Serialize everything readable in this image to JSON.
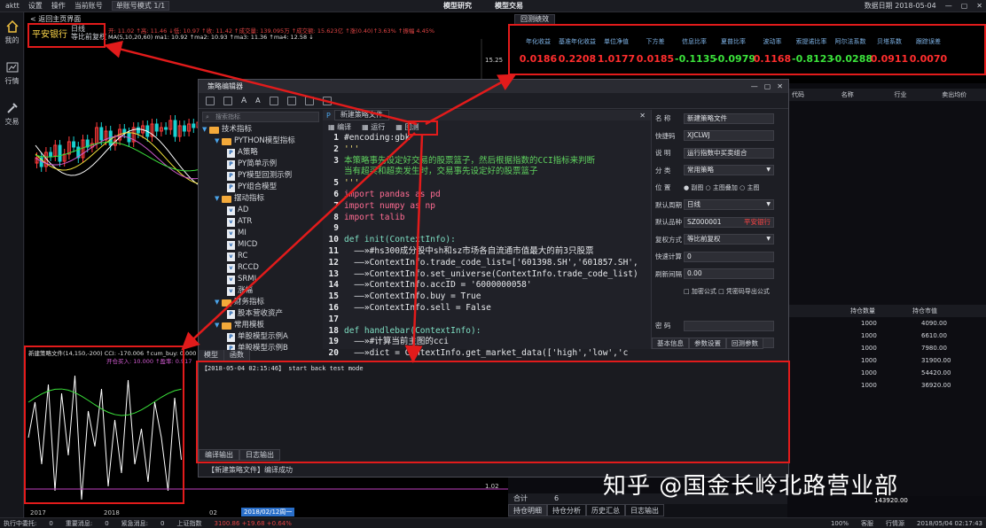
{
  "topbar": {
    "app": "aktt",
    "settings": "设置",
    "operate": "操作",
    "account": "当前账号",
    "mode": "单账号模式 1/1",
    "model_research": "模型研究",
    "model_trade": "模型交易",
    "data_date": "数据日期 2018-05-04"
  },
  "leftnav": [
    "我的",
    "行情",
    "交易"
  ],
  "chart": {
    "back": "< 返回主页界面",
    "stock": "平安银行",
    "period": "日线",
    "adjust": "等比前复权",
    "ohlc": "开: 11.02 ↑高: 11.46 ↓低: 10.97 ↑收: 11.42 ↑成交量: 139.095万 ↑成交额: 15.623亿 ↑涨(0.40)↑3.63% ↑振幅 4.45%",
    "ma": "MA(5,10,20,60) ma1: 10.92 ↑ma2: 10.93 ↑ma3: 11.36 ↑ma4: 12.58 ↓",
    "price_top": "15.25",
    "indicator": "新建策略文件(14,150,-200) CCI: -170.006 ↑cum_buy: 0.000",
    "indicator2": "开仓买入: 10.000 ↑盈率: 0.917",
    "cci_level": "1.02",
    "x_labels": [
      "2017",
      "2018",
      "02",
      "2018/02/12周一"
    ]
  },
  "backtest": {
    "tab": "回测绩效",
    "metrics": [
      {
        "label": "年化收益",
        "value": "0.0186",
        "color": "#ff2d2d"
      },
      {
        "label": "基准年化收益",
        "value": "0.2208",
        "color": "#ff2d2d"
      },
      {
        "label": "单位净值",
        "value": "1.0177",
        "color": "#ff2d2d"
      },
      {
        "label": "下方差",
        "value": "0.0185",
        "color": "#ff2d2d"
      },
      {
        "label": "信息比率",
        "value": "-0.1135",
        "color": "#3be33b"
      },
      {
        "label": "夏普比率",
        "value": "-0.0979",
        "color": "#3be33b"
      },
      {
        "label": "波动率",
        "value": "0.1168",
        "color": "#ff2d2d"
      },
      {
        "label": "索提诺比率",
        "value": "-0.8123",
        "color": "#3be33b"
      },
      {
        "label": "阿尔法系数",
        "value": "-0.0288",
        "color": "#3be33b"
      },
      {
        "label": "贝塔系数",
        "value": "0.0911",
        "color": "#ff2d2d"
      },
      {
        "label": "跟踪误差",
        "value": "0.0070",
        "color": "#ff2d2d"
      }
    ]
  },
  "grid": {
    "headers1": [
      "代码",
      "名称",
      "行业",
      "卖出均价"
    ],
    "headers2": [
      "持仓数量",
      "持仓市值"
    ],
    "rows": [
      [
        "1000",
        "4090.00"
      ],
      [
        "1000",
        "6610.00"
      ],
      [
        "1000",
        "7980.00"
      ],
      [
        "1000",
        "31900.00"
      ],
      [
        "1000",
        "54420.00"
      ],
      [
        "1000",
        "36920.00"
      ]
    ]
  },
  "editor": {
    "title": "策略编辑器",
    "tree_search": "搜索指标",
    "tree": [
      {
        "type": "folder",
        "level": 0,
        "label": "技术指标"
      },
      {
        "type": "folder",
        "level": 1,
        "label": "PYTHON模型指标"
      },
      {
        "type": "file",
        "level": 2,
        "icon": "P",
        "label": "A策略"
      },
      {
        "type": "file",
        "level": 2,
        "icon": "P",
        "label": "PY简单示例"
      },
      {
        "type": "file",
        "level": 2,
        "icon": "P",
        "label": "PY模型回测示例"
      },
      {
        "type": "file",
        "level": 2,
        "icon": "P",
        "label": "PY组合模型"
      },
      {
        "type": "folder",
        "level": 1,
        "label": "摆动指标"
      },
      {
        "type": "file",
        "level": 2,
        "icon": "v",
        "label": "AD"
      },
      {
        "type": "file",
        "level": 2,
        "icon": "v",
        "label": "ATR"
      },
      {
        "type": "file",
        "level": 2,
        "icon": "v",
        "label": "MI"
      },
      {
        "type": "file",
        "level": 2,
        "icon": "v",
        "label": "MICD"
      },
      {
        "type": "file",
        "level": 2,
        "icon": "v",
        "label": "RC"
      },
      {
        "type": "file",
        "level": 2,
        "icon": "v",
        "label": "RCCD"
      },
      {
        "type": "file",
        "level": 2,
        "icon": "v",
        "label": "SRMI"
      },
      {
        "type": "file",
        "level": 2,
        "icon": "v",
        "label": "涨幅"
      },
      {
        "type": "folder",
        "level": 1,
        "label": "财务指标"
      },
      {
        "type": "file",
        "level": 2,
        "icon": "P",
        "label": "股本营收资产"
      },
      {
        "type": "folder",
        "level": 1,
        "label": "常用模板"
      },
      {
        "type": "file",
        "level": 2,
        "icon": "P",
        "label": "单股模型示例A"
      },
      {
        "type": "file",
        "level": 2,
        "icon": "P",
        "label": "单股模型示例B"
      }
    ],
    "tree_tabs": [
      "模型",
      "函数"
    ],
    "code_tab": "新建策略文件",
    "code_toolbar": [
      "编译",
      "运行",
      "回测"
    ],
    "code": [
      {
        "n": "1",
        "t": "#encoding:gbk",
        "c": "ct"
      },
      {
        "n": "2",
        "t": "'''",
        "c": "st"
      },
      {
        "n": "3",
        "t": "本策略事先设定好交易的股票篮子，然后根据指数的CCI指标来判断",
        "c": "cm"
      },
      {
        "n": "",
        "t": "当有超买和超卖发生时，交易事先设定好的股票篮子",
        "c": "cm"
      },
      {
        "n": "5",
        "t": "'''",
        "c": "st"
      },
      {
        "n": "6",
        "t": "import pandas as pd",
        "c": "kw"
      },
      {
        "n": "7",
        "t": "import numpy as np",
        "c": "kw"
      },
      {
        "n": "8",
        "t": "import talib",
        "c": "kw"
      },
      {
        "n": "9",
        "t": "",
        "c": "ct"
      },
      {
        "n": "10",
        "t": "def init(ContextInfo):",
        "c": "fn"
      },
      {
        "n": "11",
        "t": "  ——»#hs300成分股中sh和sz市场各自流通市值最大的前3只股票",
        "c": "ct"
      },
      {
        "n": "12",
        "t": "  ——»ContextInfo.trade_code_list=['601398.SH','601857.SH',",
        "c": "ct"
      },
      {
        "n": "13",
        "t": "  ——»ContextInfo.set_universe(ContextInfo.trade_code_list)",
        "c": "ct"
      },
      {
        "n": "14",
        "t": "  ——»ContextInfo.accID = '6000000058'",
        "c": "ct"
      },
      {
        "n": "15",
        "t": "  ——»ContextInfo.buy = True",
        "c": "ct"
      },
      {
        "n": "16",
        "t": "  ——»ContextInfo.sell = False",
        "c": "ct"
      },
      {
        "n": "17",
        "t": "",
        "c": "ct"
      },
      {
        "n": "18",
        "t": "def handlebar(ContextInfo):",
        "c": "fn"
      },
      {
        "n": "19",
        "t": "  ——»#计算当前主图的cci",
        "c": "ct"
      },
      {
        "n": "20",
        "t": "  ——»dict = ContextInfo.get_market_data(['high','low','c",
        "c": "ct"
      }
    ],
    "props": [
      {
        "label": "名  称",
        "value": "新建策略文件"
      },
      {
        "label": "快捷码",
        "value": "XJCLWJ"
      },
      {
        "label": "说  明",
        "value": "运行指数中买卖组合"
      },
      {
        "label": "分  类",
        "value": "常用策略",
        "dd": true
      },
      {
        "label": "位  置",
        "value": "● 副图  ○ 主图叠加  ○ 主图",
        "plain": true
      },
      {
        "label": "默认周期",
        "value": "日线",
        "dd": true
      },
      {
        "label": "默认品种",
        "value": "SZ000001",
        "extra": "平安银行"
      },
      {
        "label": "复权方式",
        "value": "等比前复权",
        "dd": true
      },
      {
        "label": "快速计算",
        "value": "0"
      },
      {
        "label": "刷新间隔",
        "value": "0.00"
      },
      {
        "label": "",
        "value": "□ 加密公式   □ 凭密码导出公式",
        "plain": true
      },
      {
        "label": "",
        "value": "",
        "plain": true
      },
      {
        "label": "密  码",
        "value": ""
      },
      {
        "label": "确认密码",
        "value": ""
      }
    ],
    "props_tabs": [
      "基本信息",
      "参数设置",
      "回测参数"
    ],
    "log_line": "【2018-05-04 02:15:46】 start back test mode",
    "log_tabs": [
      "编译输出",
      "日志输出"
    ],
    "status": "【新建策略文件】编译成功"
  },
  "bottomtabs": {
    "total_label": "合计",
    "total_count": "6",
    "total_value": "143920.00",
    "tabs": [
      "持仓明细",
      "持仓分析",
      "历史汇总",
      "日志输出"
    ]
  },
  "bottombar": {
    "left": [
      "执行中委托:",
      "0",
      "重要消息:",
      "0",
      "紧急消息:",
      "0"
    ],
    "index": "上证指数",
    "index_val": "3100.86 +19.68 +0.64%",
    "zoom": "100%",
    "service": "客服",
    "quote": "行情源",
    "time": "2018/05/04 02:17:43"
  },
  "watermark": "知乎 @国金长岭北路营业部"
}
